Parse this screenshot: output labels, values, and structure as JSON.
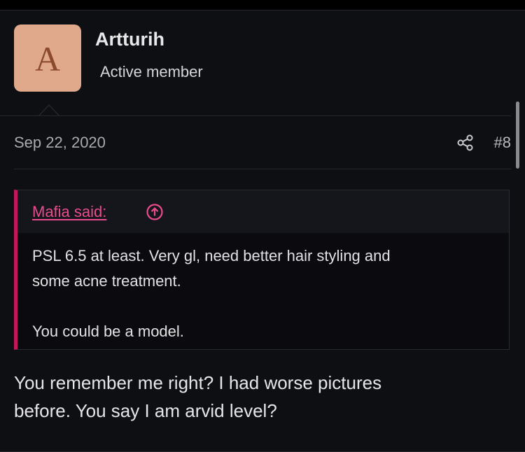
{
  "user": {
    "avatar_letter": "A",
    "name": "Artturih",
    "title": "Active member"
  },
  "post": {
    "date": "Sep 22, 2020",
    "share_icon": "share-icon",
    "number": "#8"
  },
  "quote": {
    "author": "Mafia said:",
    "jump_icon": "arrow-up-circle-icon",
    "lines": [
      "PSL 6.5 at least. Very gl, need better hair styling and",
      "some acne treatment.",
      "You could be a model."
    ]
  },
  "reply": {
    "lines": [
      "You remember me right? I had worse pictures",
      "before. You say I am arvid level?"
    ]
  },
  "colors": {
    "background": "#0e0f13",
    "accent": "#e84c8e",
    "quote_bar": "#c2185b",
    "avatar": "#e0a98b"
  }
}
